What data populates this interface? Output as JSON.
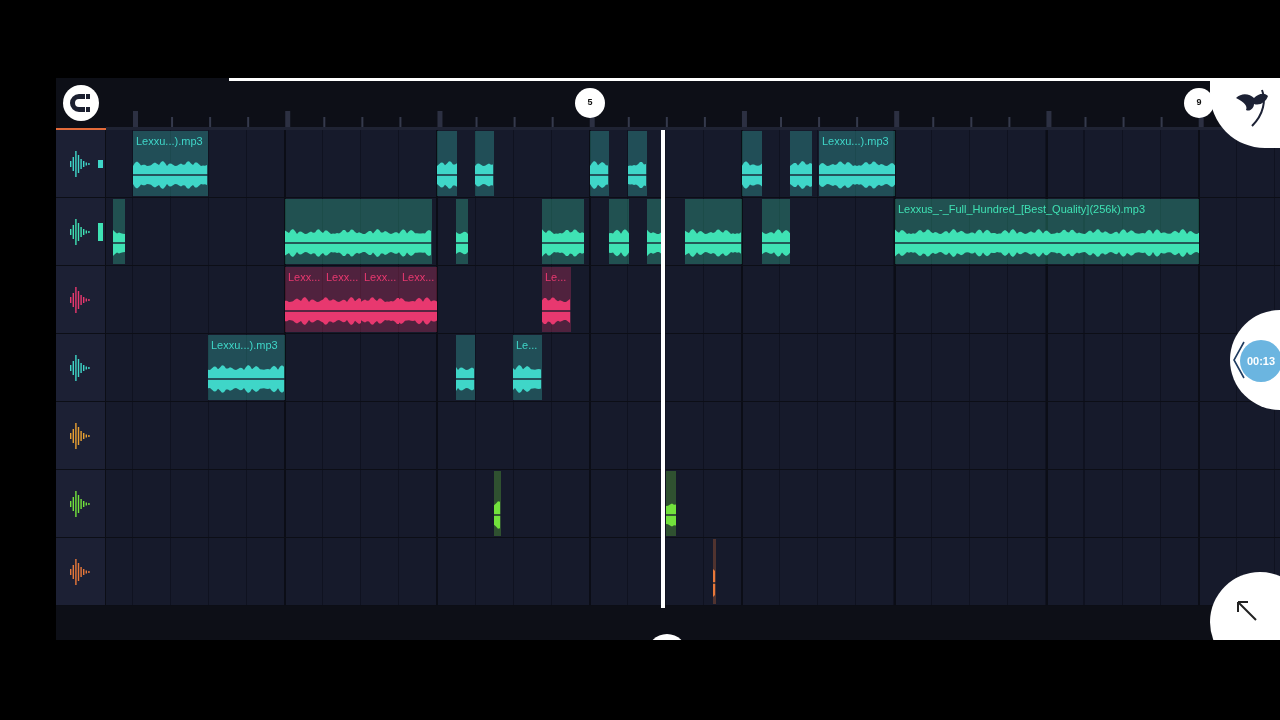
{
  "ruler": {
    "markers": [
      "5",
      "9"
    ]
  },
  "tracks": [
    {
      "color": "#3fd6c8",
      "clips": [
        {
          "label": "Lexxu...).mp3"
        },
        {
          "label": "Lexxu...).mp3"
        }
      ]
    },
    {
      "color": "#3fe2b4",
      "clips": [
        {
          "label": "Lexxus_-_Full_Hundred_[Best_Quality](256k).mp3"
        }
      ]
    },
    {
      "color": "#e8386f",
      "clips": [
        {
          "label": "Lexx..."
        },
        {
          "label": "Lexx..."
        },
        {
          "label": "Lexx..."
        },
        {
          "label": "Lexx..."
        },
        {
          "label": "Le..."
        }
      ]
    },
    {
      "color": "#3fd6c8",
      "clips": [
        {
          "label": "Lexxu...).mp3"
        },
        {
          "label": "Le..."
        }
      ]
    },
    {
      "color": "#e8a032"
    },
    {
      "color": "#72e23c"
    },
    {
      "color": "#e8783a"
    }
  ],
  "time_badge": "00:13"
}
